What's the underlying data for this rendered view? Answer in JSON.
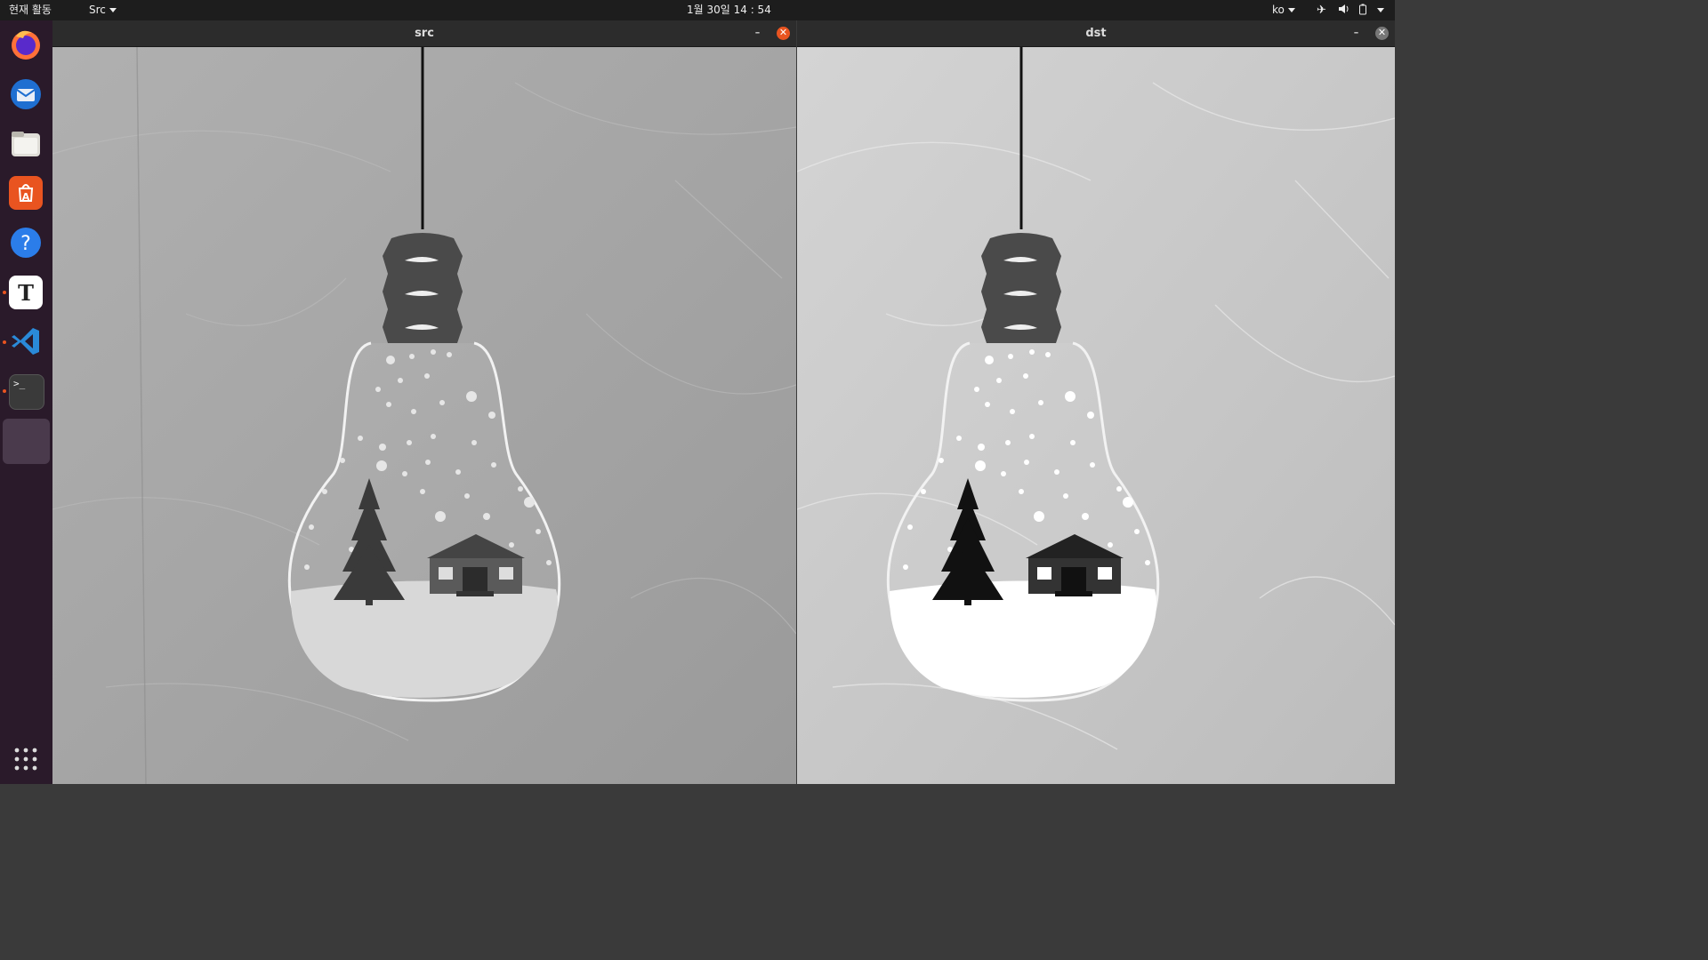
{
  "topbar": {
    "activities": "현재 활동",
    "app_menu": "Src",
    "clock": "1월 30일  14 : 54",
    "lang": "ko"
  },
  "dock": {
    "apps": [
      "firefox-icon",
      "thunderbird-icon",
      "files-icon",
      "software-center-icon",
      "help-icon",
      "text-editor-icon",
      "vscode-icon",
      "terminal-icon",
      "active-window-icon"
    ]
  },
  "windows": {
    "src": {
      "title": "src"
    },
    "dst": {
      "title": "dst"
    }
  },
  "colors": {
    "accent": "#e95420",
    "topbar": "#1d1d1d",
    "dock": "#2a1a2a",
    "titlebar": "#2c2c2c"
  }
}
